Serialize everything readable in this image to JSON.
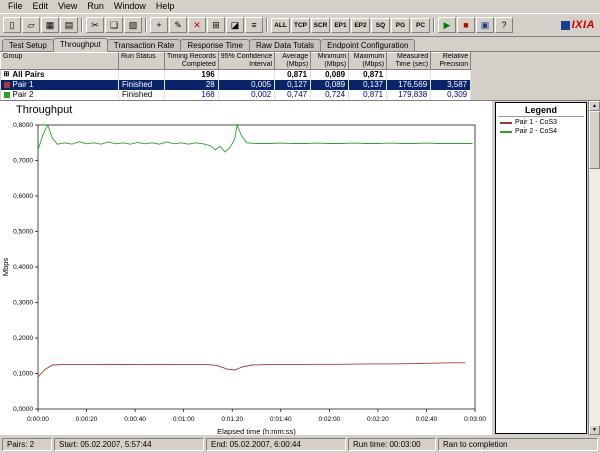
{
  "menu": {
    "items": [
      "File",
      "Edit",
      "View",
      "Run",
      "Window",
      "Help"
    ]
  },
  "toolbar": {
    "icon_groups": [
      [
        "new-icon",
        "open-icon",
        "save-icon",
        "print-icon"
      ],
      [
        "cut-icon",
        "copy-icon",
        "paste-icon"
      ],
      [
        "add-pair-icon",
        "edit-pair-icon",
        "delete-pair-icon",
        "group-icon",
        "chart-icon",
        "report-icon"
      ]
    ],
    "text_buttons": [
      "ALL",
      "TCP",
      "SCR",
      "EP1",
      "EP2",
      "SQ",
      "PG",
      "PC"
    ],
    "right_icons": [
      "run-icon",
      "stop-icon",
      "window-icon",
      "help-icon"
    ],
    "logo": "IXIA"
  },
  "tabs": {
    "items": [
      {
        "label": "Test Setup",
        "active": false
      },
      {
        "label": "Throughput",
        "active": true
      },
      {
        "label": "Transaction Rate",
        "active": false
      },
      {
        "label": "Response Time",
        "active": false
      },
      {
        "label": "Raw Data Totals",
        "active": false
      },
      {
        "label": "Endpoint Configuration",
        "active": false
      }
    ]
  },
  "table": {
    "headers": [
      {
        "l1": "Group",
        "l2": "",
        "num": false
      },
      {
        "l1": "Run Status",
        "l2": "",
        "num": false
      },
      {
        "l1": "Timing Records",
        "l2": "Completed",
        "num": true
      },
      {
        "l1": "95% Confidence",
        "l2": "Interval",
        "num": true
      },
      {
        "l1": "Average",
        "l2": "(Mbps)",
        "num": true
      },
      {
        "l1": "Minimum",
        "l2": "(Mbps)",
        "num": true
      },
      {
        "l1": "Maximum",
        "l2": "(Mbps)",
        "num": true
      },
      {
        "l1": "Measured",
        "l2": "Time (sec)",
        "num": true
      },
      {
        "l1": "Relative",
        "l2": "Precision",
        "num": true
      }
    ],
    "rows": [
      {
        "icon": "all-pairs-icon",
        "selected": false,
        "bold": true,
        "cells": [
          "All Pairs",
          "",
          "196",
          "",
          "0,871",
          "0,089",
          "0,871",
          "",
          ""
        ]
      },
      {
        "icon": "pair1-icon",
        "selected": true,
        "bold": false,
        "cells": [
          "Pair 1",
          "Finished",
          "28",
          "0,005",
          "0,127",
          "0,089",
          "0,137",
          "176,569",
          "3,587"
        ]
      },
      {
        "icon": "pair2-icon",
        "selected": false,
        "bold": false,
        "cells": [
          "Pair 2",
          "Finished",
          "168",
          "0,002",
          "0,747",
          "0,724",
          "0,871",
          "179,838",
          "0,309"
        ]
      }
    ]
  },
  "chart_data": {
    "type": "line",
    "title": "Throughput",
    "xlabel": "Elapsed time (h:mm:ss)",
    "ylabel": "Mbps",
    "xlim_seconds": [
      0,
      180
    ],
    "ylim": [
      0,
      0.8
    ],
    "grid": false,
    "legend_position": "right-panel",
    "x_ticks": [
      {
        "t": 0,
        "label": "0:00:00"
      },
      {
        "t": 20,
        "label": "0:00:20"
      },
      {
        "t": 40,
        "label": "0:00:40"
      },
      {
        "t": 60,
        "label": "0:01:00"
      },
      {
        "t": 80,
        "label": "0:01:20"
      },
      {
        "t": 100,
        "label": "0:01:40"
      },
      {
        "t": 120,
        "label": "0:02:00"
      },
      {
        "t": 140,
        "label": "0:02:20"
      },
      {
        "t": 160,
        "label": "0:02:40"
      },
      {
        "t": 180,
        "label": "0:03:00"
      }
    ],
    "y_ticks": [
      {
        "v": 0.0,
        "label": "0,0000"
      },
      {
        "v": 0.1,
        "label": "0,1000"
      },
      {
        "v": 0.2,
        "label": "0,2000"
      },
      {
        "v": 0.3,
        "label": "0,3000"
      },
      {
        "v": 0.4,
        "label": "0,4000"
      },
      {
        "v": 0.5,
        "label": "0,5000"
      },
      {
        "v": 0.6,
        "label": "0,6000"
      },
      {
        "v": 0.7,
        "label": "0,7000"
      },
      {
        "v": 0.8,
        "label": "0,8000"
      }
    ],
    "series": [
      {
        "name": "Pair 1 - CoS3",
        "color": "#a33a33",
        "points": [
          [
            0,
            0.09
          ],
          [
            3,
            0.112
          ],
          [
            6,
            0.124
          ],
          [
            10,
            0.125
          ],
          [
            20,
            0.125
          ],
          [
            30,
            0.126
          ],
          [
            40,
            0.125
          ],
          [
            50,
            0.126
          ],
          [
            60,
            0.125
          ],
          [
            70,
            0.125
          ],
          [
            74,
            0.122
          ],
          [
            78,
            0.112
          ],
          [
            81,
            0.11
          ],
          [
            84,
            0.118
          ],
          [
            88,
            0.124
          ],
          [
            95,
            0.125
          ],
          [
            105,
            0.125
          ],
          [
            115,
            0.126
          ],
          [
            125,
            0.126
          ],
          [
            135,
            0.127
          ],
          [
            145,
            0.127
          ],
          [
            155,
            0.128
          ],
          [
            163,
            0.129
          ],
          [
            170,
            0.13
          ],
          [
            176,
            0.13
          ]
        ]
      },
      {
        "name": "Pair 2 - CoS4",
        "color": "#2e9e2e",
        "points": [
          [
            0,
            0.73
          ],
          [
            2,
            0.772
          ],
          [
            4,
            0.8
          ],
          [
            6,
            0.762
          ],
          [
            8,
            0.746
          ],
          [
            11,
            0.75
          ],
          [
            14,
            0.746
          ],
          [
            17,
            0.753
          ],
          [
            20,
            0.747
          ],
          [
            23,
            0.75
          ],
          [
            26,
            0.746
          ],
          [
            29,
            0.752
          ],
          [
            32,
            0.747
          ],
          [
            35,
            0.75
          ],
          [
            38,
            0.746
          ],
          [
            41,
            0.751
          ],
          [
            44,
            0.747
          ],
          [
            47,
            0.75
          ],
          [
            50,
            0.746
          ],
          [
            53,
            0.752
          ],
          [
            56,
            0.747
          ],
          [
            59,
            0.75
          ],
          [
            62,
            0.746
          ],
          [
            65,
            0.75
          ],
          [
            68,
            0.747
          ],
          [
            71,
            0.742
          ],
          [
            73,
            0.73
          ],
          [
            75,
            0.74
          ],
          [
            77,
            0.724
          ],
          [
            79,
            0.736
          ],
          [
            81,
            0.76
          ],
          [
            82,
            0.8
          ],
          [
            84,
            0.768
          ],
          [
            86,
            0.75
          ],
          [
            90,
            0.748
          ],
          [
            95,
            0.748
          ],
          [
            100,
            0.749
          ],
          [
            105,
            0.748
          ],
          [
            110,
            0.748
          ],
          [
            115,
            0.749
          ],
          [
            120,
            0.748
          ],
          [
            125,
            0.748
          ],
          [
            130,
            0.749
          ],
          [
            135,
            0.748
          ],
          [
            140,
            0.748
          ],
          [
            145,
            0.749
          ],
          [
            150,
            0.748
          ],
          [
            155,
            0.748
          ],
          [
            160,
            0.749
          ],
          [
            165,
            0.748
          ],
          [
            170,
            0.748
          ],
          [
            175,
            0.748
          ],
          [
            179,
            0.748
          ]
        ]
      }
    ]
  },
  "legend": {
    "title": "Legend",
    "entries": [
      {
        "label": "Pair 1 - CoS3",
        "color": "#a33a33"
      },
      {
        "label": "Pair 2 - CoS4",
        "color": "#2e9e2e"
      }
    ]
  },
  "statusbar": {
    "segments": [
      "Pairs: 2",
      "Start: 05.02.2007, 5:57:44",
      "End: 05.02.2007, 6:00:44",
      "Run time: 00:03:00",
      "Ran to completion"
    ]
  }
}
